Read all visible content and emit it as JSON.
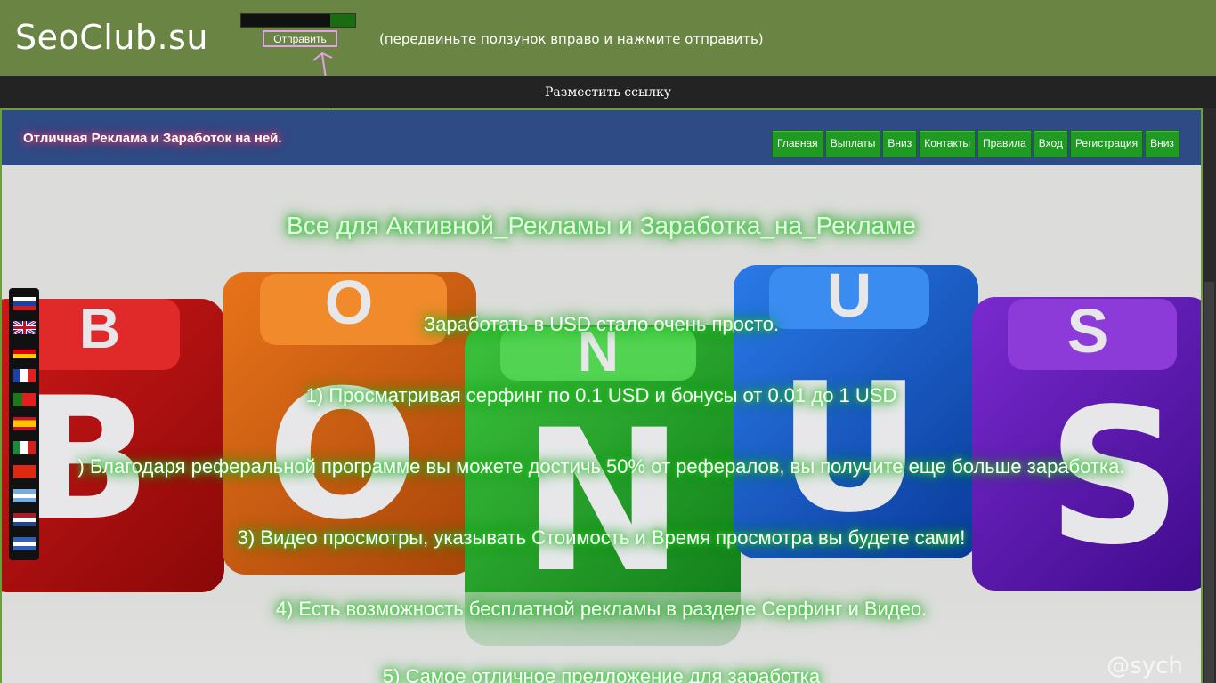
{
  "site": {
    "logo": "SeoClub.su"
  },
  "captcha": {
    "send_button": "Отправить",
    "hint": "(передвиньте ползунок вправо и нажмите отправить)",
    "slider_progress": 0.22
  },
  "linkbar": {
    "text": "Разместить ссылку"
  },
  "navbar": {
    "brand": "Отличная Реклама и Заработок на ней.",
    "items": [
      "Главная",
      "Выплаты",
      "Вниз",
      "Контакты",
      "Правила",
      "Вход",
      "Регистрация",
      "Вниз"
    ]
  },
  "hero": {
    "title": "Все для Активной_Рекламы и Заработка_на_Рекламе",
    "lines": [
      "Заработать в USD стало очень просто.",
      "1) Просматривая серфинг по 0.1 USD и бонусы от 0.01 до 1 USD",
      ") Благодаря реферальной программе вы можете достичь 50% от рефералов, вы получите еще больше заработка.",
      "3) Видео просмотры, указывать Стоимость и Время просмотра вы будете сами!",
      "4) Есть возможность бесплатной рекламы в разделе Серфинг и Видео.",
      "5) Самое отличное предложение для заработка"
    ],
    "cube_letters": [
      "B",
      "O",
      "N",
      "U",
      "S"
    ],
    "cube_top_letters": [
      "B",
      "O",
      "N",
      "U",
      "S"
    ],
    "watermark": "@sych"
  },
  "languages": [
    "ru",
    "en",
    "de",
    "fr",
    "pt",
    "es",
    "it",
    "zh",
    "ar",
    "nl",
    "sv"
  ],
  "colors": {
    "topbar": "#6a8444",
    "navbar": "#2e4b86",
    "nav_button": "#1f9a23",
    "accent_border": "#e3a1e6"
  }
}
